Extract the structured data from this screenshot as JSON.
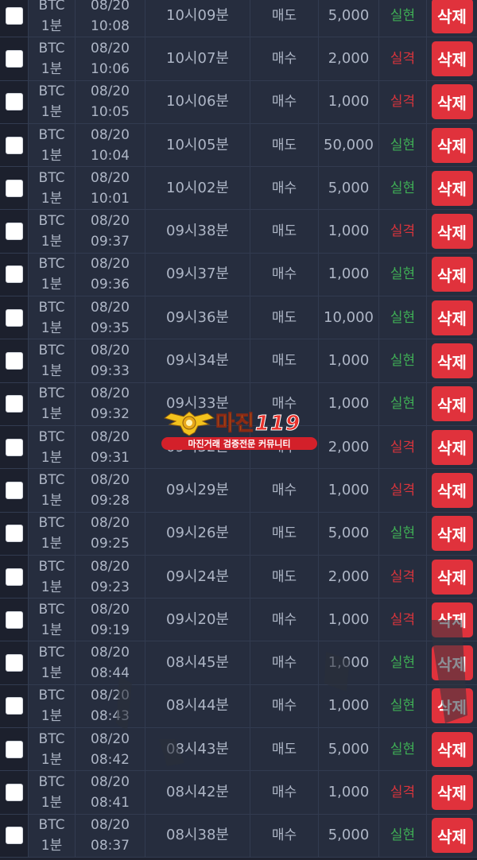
{
  "delete_label": "삭제",
  "colors": {
    "background": "#1e2230",
    "win": "#3fae55",
    "loss": "#d7343c",
    "delete_button": "#e0323c"
  },
  "watermark": {
    "title": "마진",
    "title_suffix": "119",
    "subtitle": "마진거래 검증전문 커뮤니티",
    "emblem_icon": "winged-emblem-icon"
  },
  "rows": [
    {
      "symbol": "BTC",
      "interval": "1분",
      "date": "08/20",
      "clock": "10:08",
      "round": "10시09분",
      "side": "매도",
      "amount": "5,000",
      "result": "실현",
      "result_type": "win"
    },
    {
      "symbol": "BTC",
      "interval": "1분",
      "date": "08/20",
      "clock": "10:06",
      "round": "10시07분",
      "side": "매수",
      "amount": "2,000",
      "result": "실격",
      "result_type": "loss"
    },
    {
      "symbol": "BTC",
      "interval": "1분",
      "date": "08/20",
      "clock": "10:05",
      "round": "10시06분",
      "side": "매수",
      "amount": "1,000",
      "result": "실격",
      "result_type": "loss"
    },
    {
      "symbol": "BTC",
      "interval": "1분",
      "date": "08/20",
      "clock": "10:04",
      "round": "10시05분",
      "side": "매도",
      "amount": "50,000",
      "result": "실현",
      "result_type": "win"
    },
    {
      "symbol": "BTC",
      "interval": "1분",
      "date": "08/20",
      "clock": "10:01",
      "round": "10시02분",
      "side": "매수",
      "amount": "5,000",
      "result": "실현",
      "result_type": "win"
    },
    {
      "symbol": "BTC",
      "interval": "1분",
      "date": "08/20",
      "clock": "09:37",
      "round": "09시38분",
      "side": "매도",
      "amount": "1,000",
      "result": "실격",
      "result_type": "loss"
    },
    {
      "symbol": "BTC",
      "interval": "1분",
      "date": "08/20",
      "clock": "09:36",
      "round": "09시37분",
      "side": "매수",
      "amount": "1,000",
      "result": "실현",
      "result_type": "win"
    },
    {
      "symbol": "BTC",
      "interval": "1분",
      "date": "08/20",
      "clock": "09:35",
      "round": "09시36분",
      "side": "매도",
      "amount": "10,000",
      "result": "실현",
      "result_type": "win"
    },
    {
      "symbol": "BTC",
      "interval": "1분",
      "date": "08/20",
      "clock": "09:33",
      "round": "09시34분",
      "side": "매도",
      "amount": "1,000",
      "result": "실현",
      "result_type": "win"
    },
    {
      "symbol": "BTC",
      "interval": "1분",
      "date": "08/20",
      "clock": "09:32",
      "round": "09시33분",
      "side": "매수",
      "amount": "1,000",
      "result": "실현",
      "result_type": "win"
    },
    {
      "symbol": "BTC",
      "interval": "1분",
      "date": "08/20",
      "clock": "09:31",
      "round": "09시32분",
      "side": "매수",
      "amount": "2,000",
      "result": "실격",
      "result_type": "loss"
    },
    {
      "symbol": "BTC",
      "interval": "1분",
      "date": "08/20",
      "clock": "09:28",
      "round": "09시29분",
      "side": "매수",
      "amount": "1,000",
      "result": "실격",
      "result_type": "loss"
    },
    {
      "symbol": "BTC",
      "interval": "1분",
      "date": "08/20",
      "clock": "09:25",
      "round": "09시26분",
      "side": "매도",
      "amount": "5,000",
      "result": "실현",
      "result_type": "win"
    },
    {
      "symbol": "BTC",
      "interval": "1분",
      "date": "08/20",
      "clock": "09:23",
      "round": "09시24분",
      "side": "매도",
      "amount": "2,000",
      "result": "실격",
      "result_type": "loss"
    },
    {
      "symbol": "BTC",
      "interval": "1분",
      "date": "08/20",
      "clock": "09:19",
      "round": "09시20분",
      "side": "매수",
      "amount": "1,000",
      "result": "실격",
      "result_type": "loss"
    },
    {
      "symbol": "BTC",
      "interval": "1분",
      "date": "08/20",
      "clock": "08:44",
      "round": "08시45분",
      "side": "매수",
      "amount": "1,000",
      "result": "실현",
      "result_type": "win"
    },
    {
      "symbol": "BTC",
      "interval": "1분",
      "date": "08/20",
      "clock": "08:43",
      "round": "08시44분",
      "side": "매수",
      "amount": "1,000",
      "result": "실현",
      "result_type": "win"
    },
    {
      "symbol": "BTC",
      "interval": "1분",
      "date": "08/20",
      "clock": "08:42",
      "round": "08시43분",
      "side": "매도",
      "amount": "5,000",
      "result": "실현",
      "result_type": "win"
    },
    {
      "symbol": "BTC",
      "interval": "1분",
      "date": "08/20",
      "clock": "08:41",
      "round": "08시42분",
      "side": "매수",
      "amount": "1,000",
      "result": "실격",
      "result_type": "loss"
    },
    {
      "symbol": "BTC",
      "interval": "1분",
      "date": "08/20",
      "clock": "08:37",
      "round": "08시38분",
      "side": "매수",
      "amount": "5,000",
      "result": "실현",
      "result_type": "win"
    }
  ]
}
